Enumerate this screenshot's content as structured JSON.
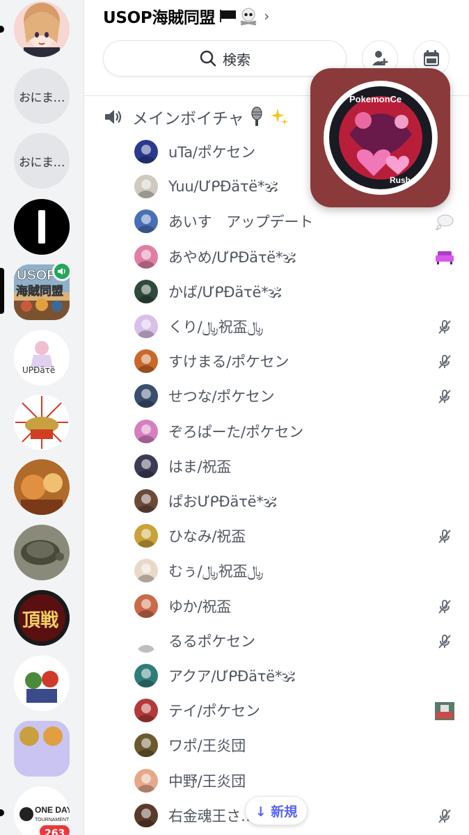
{
  "server_rail": {
    "folder_1_label": "おにま…",
    "folder_2_label": "おにま…",
    "usop_label": "USOP",
    "usop_label_2": "海賊同盟",
    "update_label": "UPĐäτë",
    "tournament_label": "頂戦",
    "one_day_label": "ONE DAY",
    "one_day_label_2": "TOURNAMENT",
    "unread_badge": "263"
  },
  "header": {
    "server_title": "USOP海賊同盟",
    "search_label": "検索"
  },
  "channel": {
    "name": "メインボイチャ"
  },
  "members": [
    {
      "name": "uTa/ポケセン",
      "status": "none",
      "color": "#2b3a8c"
    },
    {
      "name": "Yuu/ƯᑭĐäτë*🕉",
      "status": "none",
      "color": "#cfc9c0"
    },
    {
      "name": "あいす　アップデート",
      "status": "thought",
      "color": "#4a6fb5"
    },
    {
      "name": "あやめ/ƯᑭĐäτë*🕉",
      "status": "pixel-sofa",
      "color": "#e07fa6"
    },
    {
      "name": "かば/ƯᑭĐäτë*🕉",
      "status": "none",
      "color": "#2f4a3a"
    },
    {
      "name": "くり/﷼祝盃﷼",
      "status": "muted",
      "color": "#d8c0e8"
    },
    {
      "name": "すけまる/ポケセン",
      "status": "muted",
      "color": "#c8692a"
    },
    {
      "name": "せつな/ポケセン",
      "status": "muted",
      "color": "#3a4e6e"
    },
    {
      "name": "ぞろぱーた/ポケセン",
      "status": "none",
      "color": "#d47fc0"
    },
    {
      "name": "はま/祝盃",
      "status": "none",
      "color": "#3b3b55"
    },
    {
      "name": "ぱおƯᑭĐäτë*🕉",
      "status": "none",
      "color": "#6a4b3a"
    },
    {
      "name": "ひなみ/祝盃",
      "status": "muted",
      "color": "#c9a23a"
    },
    {
      "name": "むぅ/﷼祝盃﷼",
      "status": "none",
      "color": "#e8d9c9"
    },
    {
      "name": "ゆか/祝盃",
      "status": "muted",
      "color": "#c96a4a"
    },
    {
      "name": "るるポケセン",
      "status": "muted",
      "color": "#ffffff"
    },
    {
      "name": "アクア/ƯᑭĐäτë*🕉",
      "status": "none",
      "color": "#2f7d7a"
    },
    {
      "name": "テイ/ポケセン",
      "status": "thumbnail",
      "color": "#b23a3a"
    },
    {
      "name": "ワポ/王炎団",
      "status": "none",
      "color": "#6b5a2e"
    },
    {
      "name": "中野/王炎団",
      "status": "none",
      "color": "#e6a88a"
    },
    {
      "name": "右金魂王さ… 祝盃",
      "status": "muted",
      "color": "#5a3a2a"
    }
  ],
  "popup": {
    "top_text": "PokemonCe",
    "bottom_text": "Rush"
  },
  "new_pill": {
    "label": "↓ 新規"
  },
  "colors": {
    "rail_bg": "#f2f3f5",
    "text_muted": "#4f5660",
    "accent": "#5865f2",
    "danger": "#e8393f",
    "online": "#23a55a",
    "popup_bg": "#8a3a3b"
  }
}
